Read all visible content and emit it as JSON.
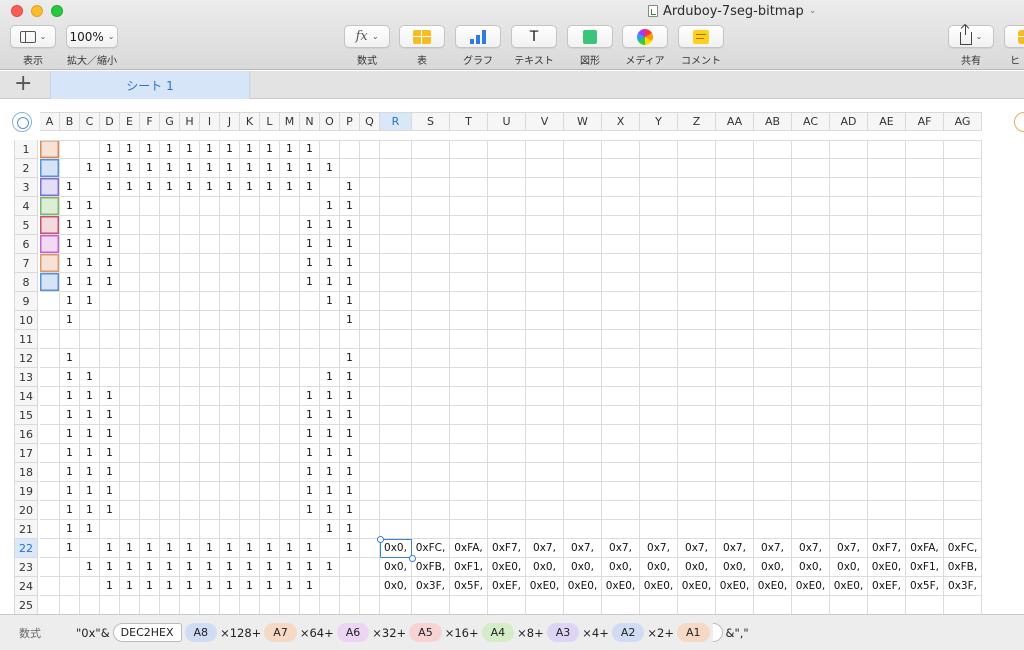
{
  "window": {
    "title": "Arduboy-7seg-bitmap",
    "title_chevron": "⌄"
  },
  "toolbar": {
    "view_label": "表示",
    "zoom_value": "100%",
    "zoom_label": "拡大／縮小",
    "formula_label": "数式",
    "formula_icon": "fx",
    "table_label": "表",
    "chart_label": "グラフ",
    "text_label": "テキスト",
    "text_icon": "T",
    "shape_label": "図形",
    "media_label": "メディア",
    "comment_label": "コメント",
    "share_label": "共有",
    "extra_label": "ヒ",
    "chevron": "⌄"
  },
  "sheets": {
    "add_label": "+",
    "tabs": [
      {
        "label": "シート 1",
        "selected": true
      }
    ]
  },
  "grid": {
    "columns": [
      "A",
      "B",
      "C",
      "D",
      "E",
      "F",
      "G",
      "H",
      "I",
      "J",
      "K",
      "L",
      "M",
      "N",
      "O",
      "P",
      "Q",
      "R",
      "S",
      "T",
      "U",
      "V",
      "W",
      "X",
      "Y",
      "Z",
      "AA",
      "AB",
      "AC",
      "AD",
      "AE",
      "AF",
      "AG"
    ],
    "selected_column": "R",
    "selected_row": 22,
    "selected_cell": "R22",
    "rows": [
      {
        "n": 1,
        "ones": [
          "D",
          "E",
          "F",
          "G",
          "H",
          "I",
          "J",
          "K",
          "L",
          "M",
          "N"
        ]
      },
      {
        "n": 2,
        "ones": [
          "C",
          "D",
          "E",
          "F",
          "G",
          "H",
          "I",
          "J",
          "K",
          "L",
          "M",
          "N",
          "O"
        ]
      },
      {
        "n": 3,
        "ones": [
          "B",
          "D",
          "E",
          "F",
          "G",
          "H",
          "I",
          "J",
          "K",
          "L",
          "M",
          "N",
          "P"
        ]
      },
      {
        "n": 4,
        "ones": [
          "B",
          "C",
          "O",
          "P"
        ]
      },
      {
        "n": 5,
        "ones": [
          "B",
          "C",
          "D",
          "N",
          "O",
          "P"
        ]
      },
      {
        "n": 6,
        "ones": [
          "B",
          "C",
          "D",
          "N",
          "O",
          "P"
        ]
      },
      {
        "n": 7,
        "ones": [
          "B",
          "C",
          "D",
          "N",
          "O",
          "P"
        ]
      },
      {
        "n": 8,
        "ones": [
          "B",
          "C",
          "D",
          "N",
          "O",
          "P"
        ]
      },
      {
        "n": 9,
        "ones": [
          "B",
          "C",
          "O",
          "P"
        ]
      },
      {
        "n": 10,
        "ones": [
          "B",
          "P"
        ]
      },
      {
        "n": 11,
        "ones": []
      },
      {
        "n": 12,
        "ones": [
          "B",
          "P"
        ]
      },
      {
        "n": 13,
        "ones": [
          "B",
          "C",
          "O",
          "P"
        ]
      },
      {
        "n": 14,
        "ones": [
          "B",
          "C",
          "D",
          "N",
          "O",
          "P"
        ]
      },
      {
        "n": 15,
        "ones": [
          "B",
          "C",
          "D",
          "N",
          "O",
          "P"
        ]
      },
      {
        "n": 16,
        "ones": [
          "B",
          "C",
          "D",
          "N",
          "O",
          "P"
        ]
      },
      {
        "n": 17,
        "ones": [
          "B",
          "C",
          "D",
          "N",
          "O",
          "P"
        ]
      },
      {
        "n": 18,
        "ones": [
          "B",
          "C",
          "D",
          "N",
          "O",
          "P"
        ]
      },
      {
        "n": 19,
        "ones": [
          "B",
          "C",
          "D",
          "N",
          "O",
          "P"
        ]
      },
      {
        "n": 20,
        "ones": [
          "B",
          "C",
          "D",
          "N",
          "O",
          "P"
        ]
      },
      {
        "n": 21,
        "ones": [
          "B",
          "C",
          "O",
          "P"
        ]
      },
      {
        "n": 22,
        "ones": [
          "B",
          "D",
          "E",
          "F",
          "G",
          "H",
          "I",
          "J",
          "K",
          "L",
          "M",
          "N",
          "P"
        ],
        "hex": [
          "0x0,",
          "0xFC,",
          "0xFA,",
          "0xF7,",
          "0x7,",
          "0x7,",
          "0x7,",
          "0x7,",
          "0x7,",
          "0x7,",
          "0x7,",
          "0x7,",
          "0x7,",
          "0xF7,",
          "0xFA,",
          "0xFC,"
        ]
      },
      {
        "n": 23,
        "ones": [
          "C",
          "D",
          "E",
          "F",
          "G",
          "H",
          "I",
          "J",
          "K",
          "L",
          "M",
          "N",
          "O"
        ],
        "hex": [
          "0x0,",
          "0xFB,",
          "0xF1,",
          "0xE0,",
          "0x0,",
          "0x0,",
          "0x0,",
          "0x0,",
          "0x0,",
          "0x0,",
          "0x0,",
          "0x0,",
          "0x0,",
          "0xE0,",
          "0xF1,",
          "0xFB,"
        ]
      },
      {
        "n": 24,
        "ones": [
          "D",
          "E",
          "F",
          "G",
          "H",
          "I",
          "J",
          "K",
          "L",
          "M",
          "N"
        ],
        "hex": [
          "0x0,",
          "0x3F,",
          "0x5F,",
          "0xEF,",
          "0xE0,",
          "0xE0,",
          "0xE0,",
          "0xE0,",
          "0xE0,",
          "0xE0,",
          "0xE0,",
          "0xE0,",
          "0xE0,",
          "0xEF,",
          "0x5F,",
          "0x3F,"
        ]
      },
      {
        "n": 25,
        "ones": []
      }
    ],
    "cell_value": "1",
    "ref_colors": {
      "A1": {
        "fill": "#f7e2d5",
        "border": "#d98a5c"
      },
      "A2": {
        "fill": "#d6e4f7",
        "border": "#5b8fd6"
      },
      "A3": {
        "fill": "#e3def8",
        "border": "#7f6ed6"
      },
      "A4": {
        "fill": "#dcefd6",
        "border": "#7ab86a"
      },
      "A5": {
        "fill": "#f4d9df",
        "border": "#c0566e"
      },
      "A6": {
        "fill": "#f2daf5",
        "border": "#c462d4"
      },
      "A7": {
        "fill": "#f7e2d5",
        "border": "#d99a6c"
      },
      "A8": {
        "fill": "#d6e4f7",
        "border": "#5b8fd6"
      }
    }
  },
  "formula_bar": {
    "label": "数式",
    "parts": [
      {
        "kind": "text",
        "text": "\"0x\"&"
      },
      {
        "kind": "fn",
        "text": "DEC2HEX"
      },
      {
        "kind": "ref",
        "text": "A8",
        "color": "#cfdcf4"
      },
      {
        "kind": "text",
        "text": "×128+"
      },
      {
        "kind": "ref",
        "text": "A7",
        "color": "#f6d9c4"
      },
      {
        "kind": "text",
        "text": "×64+"
      },
      {
        "kind": "ref",
        "text": "A6",
        "color": "#ecd4f4"
      },
      {
        "kind": "text",
        "text": "×32+"
      },
      {
        "kind": "ref",
        "text": "A5",
        "color": "#f6d4d4"
      },
      {
        "kind": "text",
        "text": "×16+"
      },
      {
        "kind": "ref",
        "text": "A4",
        "color": "#d5ecc8"
      },
      {
        "kind": "text",
        "text": "×8+"
      },
      {
        "kind": "ref",
        "text": "A3",
        "color": "#ded4f6"
      },
      {
        "kind": "text",
        "text": "×4+"
      },
      {
        "kind": "ref",
        "text": "A2",
        "color": "#cfdcf4"
      },
      {
        "kind": "text",
        "text": "×2+"
      },
      {
        "kind": "ref",
        "text": "A1",
        "color": "#f6d9c4"
      },
      {
        "kind": "fnclose",
        "text": ""
      },
      {
        "kind": "text",
        "text": "&\",\""
      }
    ]
  }
}
